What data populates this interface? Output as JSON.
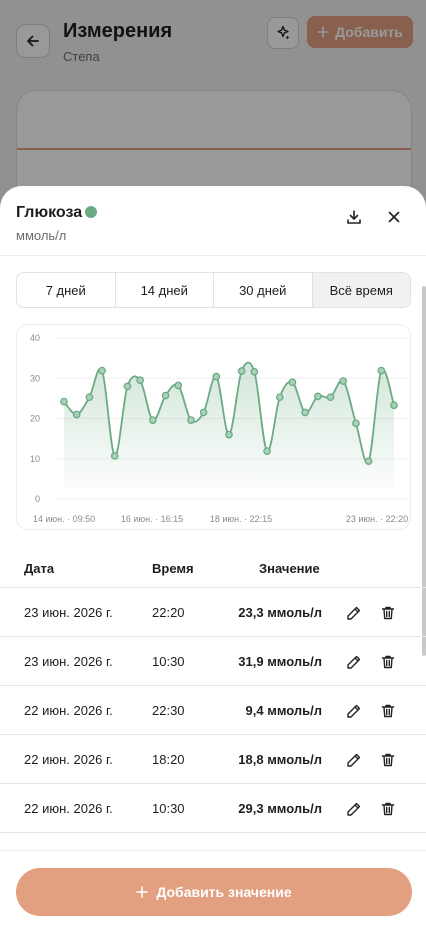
{
  "page": {
    "title": "Измерения",
    "subtitle": "Степа",
    "add_button": "Добавить"
  },
  "sheet": {
    "title": "Глюкоза",
    "unit": "ммоль/л",
    "status_color": "#6aab84",
    "range_tabs": [
      "7 дней",
      "14 дней",
      "30 дней",
      "Всё время"
    ],
    "active_tab": "Всё время"
  },
  "chart_data": {
    "type": "line",
    "y_ticks": [
      40,
      30,
      20,
      10,
      0
    ],
    "ylim": [
      0,
      40
    ],
    "x_tick_labels": [
      "14 июн. · 09:50",
      "16 июн. · 16:15",
      "18 июн. · 22:15",
      "23 июн. · 22:20"
    ],
    "grid": true,
    "values": [
      24.2,
      21.0,
      25.3,
      31.9,
      10.7,
      28.0,
      29.5,
      19.6,
      25.7,
      28.2,
      19.6,
      21.5,
      30.4,
      16.0,
      31.8,
      31.6,
      11.9,
      25.3,
      29.0,
      21.5,
      25.5,
      25.3,
      29.3,
      18.8,
      9.4,
      31.9,
      23.3
    ],
    "color": "#6aab84"
  },
  "table": {
    "headers": {
      "date": "Дата",
      "time": "Время",
      "value": "Значение"
    },
    "rows": [
      {
        "date": "23 июн. 2026 г.",
        "time": "22:20",
        "value": "23,3 ммоль/л"
      },
      {
        "date": "23 июн. 2026 г.",
        "time": "10:30",
        "value": "31,9 ммоль/л"
      },
      {
        "date": "22 июн. 2026 г.",
        "time": "22:30",
        "value": "9,4 ммоль/л"
      },
      {
        "date": "22 июн. 2026 г.",
        "time": "18:20",
        "value": "18,8 ммоль/л"
      },
      {
        "date": "22 июн. 2026 г.",
        "time": "10:30",
        "value": "29,3 ммоль/л"
      }
    ]
  },
  "footer": {
    "add_value_button": "Добавить значение"
  },
  "colors": {
    "accent": "#e3a081",
    "series": "#6aab84"
  }
}
